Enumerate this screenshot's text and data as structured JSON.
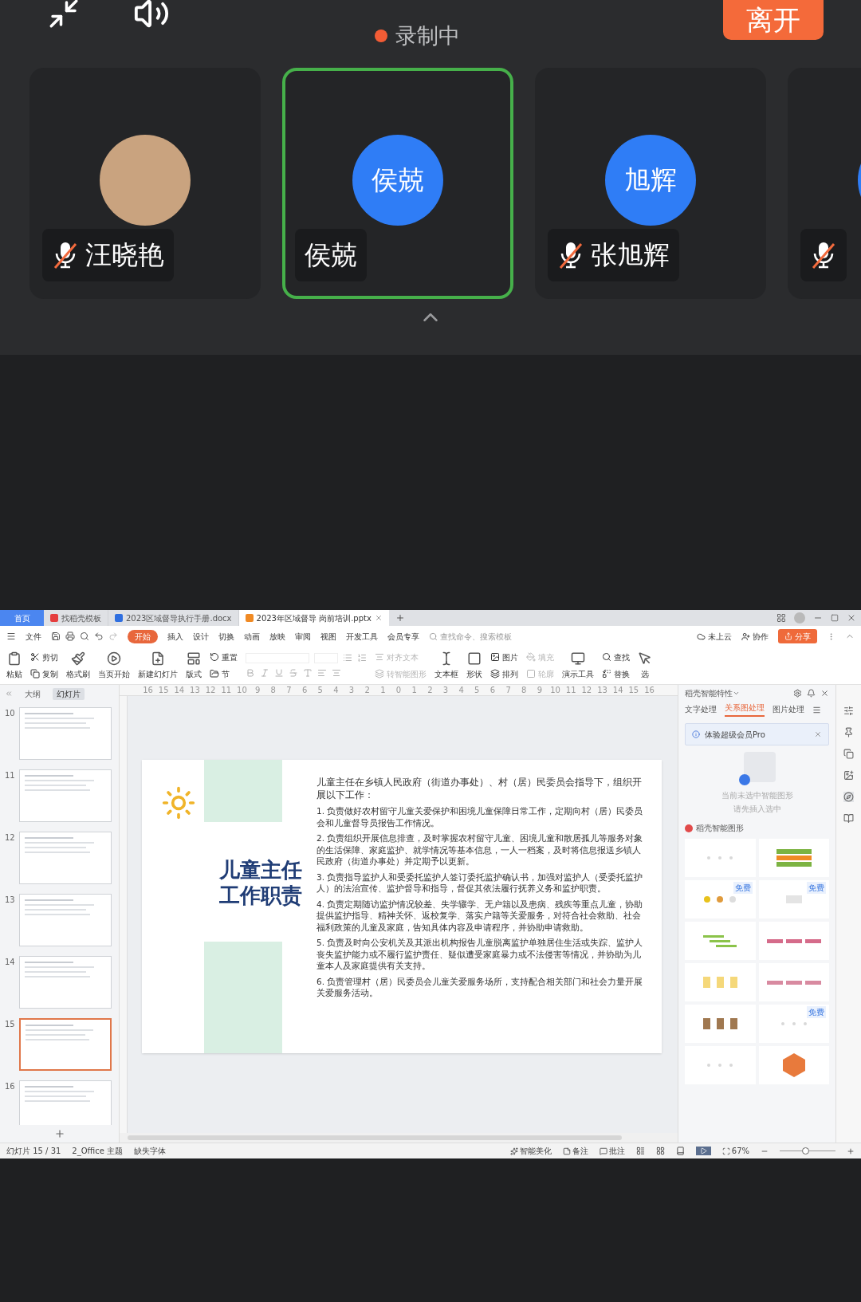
{
  "meeting": {
    "status": "录制中",
    "leave_button": "离开",
    "participants": [
      {
        "kind": "photo",
        "name": "汪晓艳",
        "muted": true,
        "selected": false
      },
      {
        "kind": "initials",
        "initials": "侯兢",
        "name": "侯兢",
        "muted": false,
        "selected": true
      },
      {
        "kind": "initials",
        "initials": "旭辉",
        "name": "张旭辉",
        "muted": true,
        "selected": false
      },
      {
        "kind": "initials",
        "muted": true,
        "selected": false
      }
    ]
  },
  "wps": {
    "tabs": [
      {
        "label": "首页",
        "kind": "home",
        "selected": false
      },
      {
        "label": "找稻壳模板",
        "kind": "docer",
        "selected": false
      },
      {
        "label": "2023区域督导执行手册.docx",
        "kind": "word",
        "selected": false
      },
      {
        "label": "2023年区域督导 岗前培训.pptx",
        "kind": "ppt",
        "selected": true
      }
    ],
    "menu": [
      {
        "label": "文件",
        "selected": false
      },
      {
        "label": "开始",
        "selected": true
      },
      {
        "label": "插入",
        "selected": false
      },
      {
        "label": "设计",
        "selected": false
      },
      {
        "label": "切换",
        "selected": false
      },
      {
        "label": "动画",
        "selected": false
      },
      {
        "label": "放映",
        "selected": false
      },
      {
        "label": "审阅",
        "selected": false
      },
      {
        "label": "视图",
        "selected": false
      },
      {
        "label": "开发工具",
        "selected": false
      },
      {
        "label": "会员专享",
        "selected": false
      }
    ],
    "search": {
      "placeholder": "查找命令、搜索模板"
    },
    "cloud": "未上云",
    "collab": "协作",
    "share": "分享",
    "ribbon": [
      {
        "kind": "large",
        "label": "粘贴"
      },
      {
        "kind": "pair",
        "items": [
          {
            "label": "剪切",
            "disabled": false
          },
          {
            "label": "复制",
            "disabled": false
          }
        ]
      },
      {
        "kind": "large",
        "label": "格式刷"
      },
      {
        "kind": "large",
        "label": "当页开始"
      },
      {
        "kind": "large",
        "label": "新建幻灯片"
      },
      {
        "kind": "large",
        "label": "版式"
      },
      {
        "kind": "pair",
        "items": [
          {
            "label": "重置",
            "disabled": false
          },
          {
            "label": "节",
            "disabled": false
          }
        ]
      },
      {
        "kind": "format"
      },
      {
        "kind": "pair",
        "items": [
          {
            "label": "对齐文本",
            "disabled": true
          },
          {
            "label": "转智能图形",
            "disabled": true
          }
        ]
      },
      {
        "kind": "large",
        "label": "文本框"
      },
      {
        "kind": "large",
        "label": "形状"
      },
      {
        "kind": "pair",
        "items": [
          {
            "label": "图片",
            "disabled": false
          },
          {
            "label": "排列",
            "disabled": false
          }
        ]
      },
      {
        "kind": "pair",
        "items": [
          {
            "label": "填充",
            "disabled": true
          },
          {
            "label": "轮廓",
            "disabled": true
          }
        ]
      },
      {
        "kind": "large",
        "label": "演示工具"
      },
      {
        "kind": "pair",
        "items": [
          {
            "label": "查找",
            "disabled": false
          },
          {
            "label": "替换",
            "disabled": false
          }
        ]
      },
      {
        "kind": "large",
        "label": "选"
      }
    ],
    "ruler": [
      "16",
      "15",
      "14",
      "13",
      "12",
      "11",
      "10",
      "9",
      "8",
      "7",
      "6",
      "5",
      "4",
      "3",
      "2",
      "1",
      "0",
      "1",
      "2",
      "3",
      "4",
      "5",
      "6",
      "7",
      "8",
      "9",
      "10",
      "11",
      "12",
      "13",
      "14",
      "15",
      "16"
    ],
    "panel_tabs": [
      {
        "label": "大纲",
        "selected": false
      },
      {
        "label": "幻灯片",
        "selected": true
      }
    ],
    "thumbnails": [
      {
        "number": "10",
        "selected": false
      },
      {
        "number": "11",
        "selected": false
      },
      {
        "number": "12",
        "selected": false
      },
      {
        "number": "13",
        "selected": false
      },
      {
        "number": "14",
        "selected": false
      },
      {
        "number": "15",
        "selected": true
      },
      {
        "number": "16",
        "selected": false
      }
    ],
    "slide": {
      "title": [
        "儿童主任",
        "工作职责"
      ],
      "intro": "儿童主任在乡镇人民政府（街道办事处）、村（居）民委员会指导下，组织开展以下工作：",
      "items": [
        "1. 负责做好农村留守儿童关爱保护和困境儿童保障日常工作，定期向村（居）民委员会和儿童督导员报告工作情况。",
        "2. 负责组织开展信息排查，及时掌握农村留守儿童、困境儿童和散居孤儿等服务对象的生活保障、家庭监护、就学情况等基本信息，一人一档案，及时将信息报送乡镇人民政府（街道办事处）并定期予以更新。",
        "3. 负责指导监护人和受委托监护人签订委托监护确认书，加强对监护人（受委托监护人）的法治宣传、监护督导和指导，督促其依法履行抚养义务和监护职责。",
        "4. 负责定期随访监护情况较差、失学辍学、无户籍以及患病、残疾等重点儿童，协助提供监护指导、精神关怀、返校复学、落实户籍等关爱服务，对符合社会救助、社会福利政策的儿童及家庭，告知具体内容及申请程序，并协助申请救助。",
        "5. 负责及时向公安机关及其派出机构报告儿童脱离监护单独居住生活或失踪、监护人丧失监护能力或不履行监护责任、疑似遭受家庭暴力或不法侵害等情况，并协助为儿童本人及家庭提供有关支持。",
        "6. 负责管理村（居）民委员会儿童关爱服务场所，支持配合相关部门和社会力量开展关爱服务活动。"
      ]
    },
    "side_panel": {
      "title": "稻壳智能特性",
      "tabs": [
        {
          "label": "文字处理",
          "selected": false
        },
        {
          "label": "关系图处理",
          "selected": true
        },
        {
          "label": "图片处理",
          "selected": false
        }
      ],
      "banner": "体验超级会员Pro",
      "empty": [
        "当前未选中智能图形",
        "请先插入选中"
      ],
      "section": "稻壳智能图形",
      "templates": [
        {
          "kind": "dots"
        },
        {
          "kind": "arrows"
        },
        {
          "kind": "timeline",
          "badge": "免费"
        },
        {
          "kind": "funnel",
          "badge": "免费"
        },
        {
          "kind": "steps"
        },
        {
          "kind": "pink"
        },
        {
          "kind": "jars"
        },
        {
          "kind": "lines"
        },
        {
          "kind": "boxes"
        },
        {
          "kind": "faint",
          "badge": "免费"
        },
        {
          "kind": "pins"
        },
        {
          "kind": "hex"
        }
      ]
    },
    "status_bar": {
      "slide": "幻灯片 15 / 31",
      "theme": "2_Office 主题",
      "missing_font": "缺失字体",
      "beautify": "智能美化",
      "notes": "备注",
      "comments": "批注",
      "zoom": "67%",
      "level": 0.45
    }
  }
}
